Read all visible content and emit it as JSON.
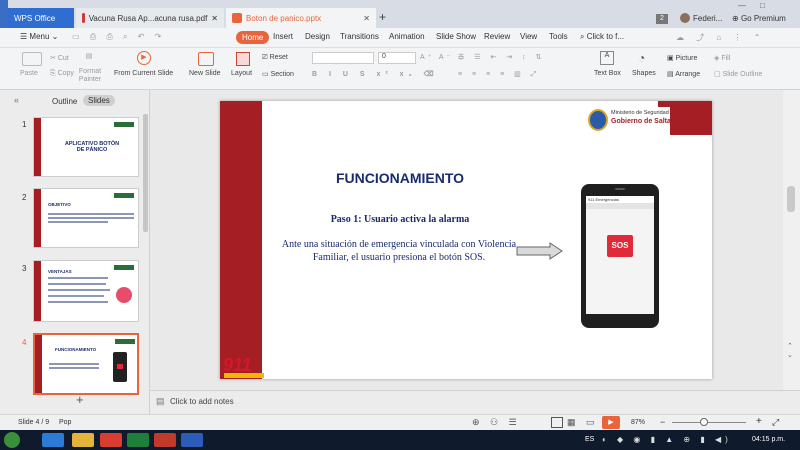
{
  "window": {
    "tabs": [
      {
        "label": "WPS Office"
      },
      {
        "label": "Vacuna Rusa Ap...acuna rusa.pdf"
      },
      {
        "label": "Boton de panico.pptx"
      }
    ],
    "tab_count_badge": "2",
    "user_name": "Federi...",
    "premium_label": "Go Premium"
  },
  "menu": {
    "menu_label": "Menu",
    "items": [
      "Home",
      "Insert",
      "Design",
      "Transitions",
      "Animation",
      "Slide Show",
      "Review",
      "View",
      "Tools"
    ],
    "search_placeholder": "Click to f..."
  },
  "ribbon": {
    "paste": "Paste",
    "cut": "Cut",
    "copy": "Copy",
    "format_painter": "Format Painter",
    "from_current_slide": "From Current Slide",
    "new_slide": "New Slide",
    "layout": "Layout",
    "reset": "Reset",
    "section": "Section",
    "font_size": "0",
    "text_box": "Text Box",
    "shapes": "Shapes",
    "picture": "Picture",
    "arrange": "Arrange",
    "fill": "Fill",
    "slide_outline": "Slide Outline"
  },
  "left_panel": {
    "tab_outline": "Outline",
    "tab_slides": "Slides",
    "thumbnails": [
      {
        "num": "1",
        "title": "APLICATIVO BOTÓN DE PÁNICO"
      },
      {
        "num": "2",
        "title": "OBJETIVO"
      },
      {
        "num": "3",
        "title": "VENTAJAS"
      },
      {
        "num": "4",
        "title": "FUNCIONAMIENTO"
      }
    ]
  },
  "slide": {
    "logo_line1": "Ministerio de Seguridad",
    "logo_line2": "Gobierno de Salta",
    "title": "FUNCIONAMIENTO",
    "subtitle": "Paso 1: Usuario activa la alarma",
    "body": "Ante una situación de emergencia vinculada con Violencia Familiar, el usuario presiona el botón SOS.",
    "phone_header": "911 Emergencias",
    "sos_label": "SOS",
    "brand": "911"
  },
  "notes": {
    "placeholder": "Click to add notes"
  },
  "status": {
    "slide_info": "Slide 4 / 9",
    "theme": "Pop",
    "zoom": "87%"
  },
  "taskbar": {
    "lang": "ES",
    "time": "04:15 p.m."
  },
  "colors": {
    "accent": "#a51e24",
    "title_blue": "#1a2b6d",
    "home_tab": "#e8643b"
  }
}
